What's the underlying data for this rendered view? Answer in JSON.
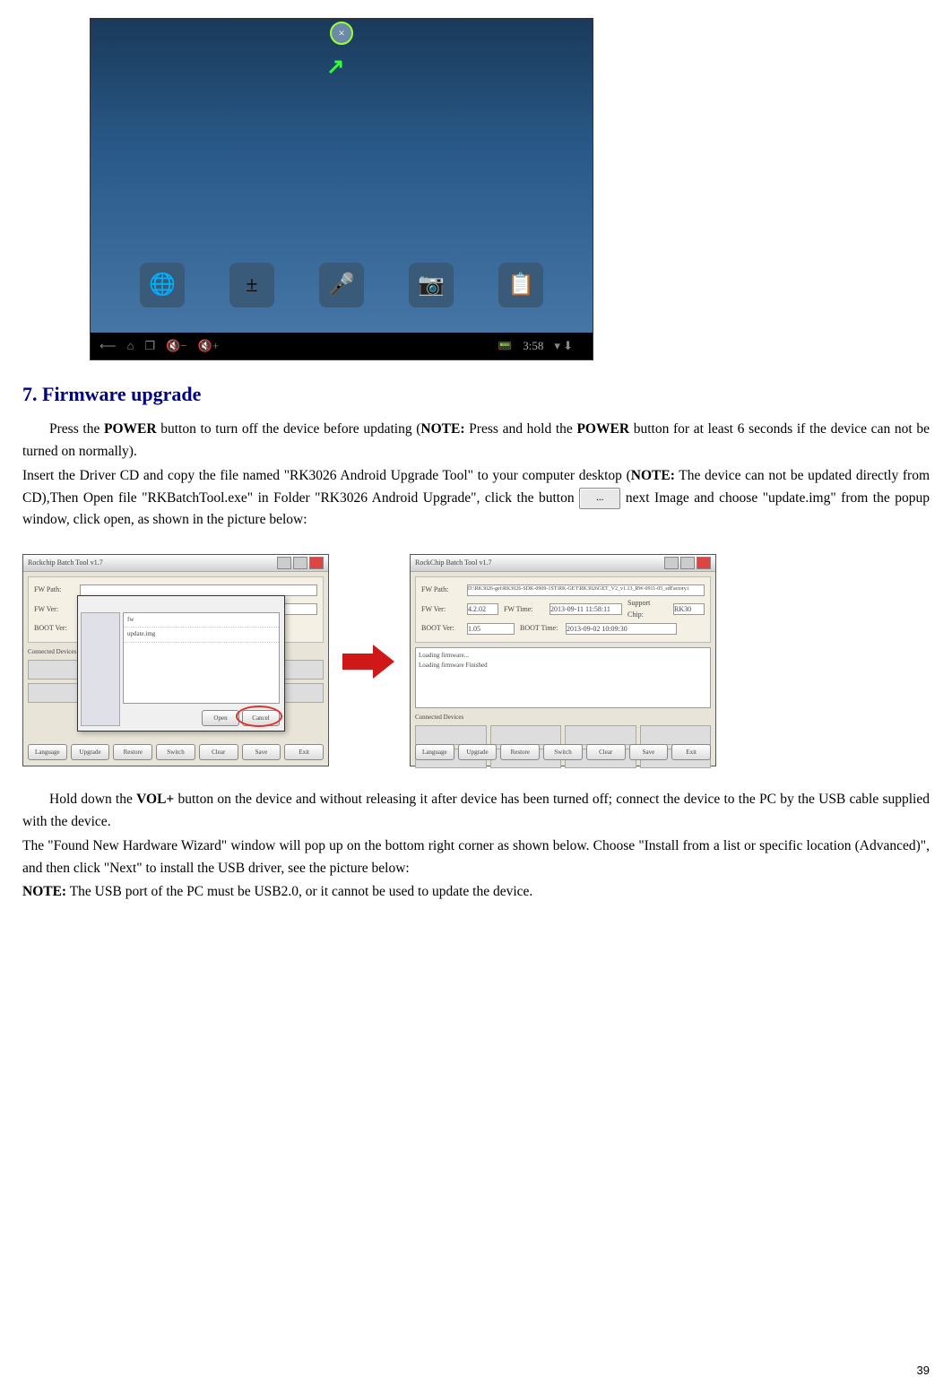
{
  "tablet": {
    "close_label": "×",
    "icons": [
      "🌐",
      "±",
      "🎤",
      "📷",
      "📋"
    ],
    "nav": [
      "⟵",
      "⌂",
      "❐",
      "🔇−",
      "🔇+"
    ],
    "time": "3:58",
    "status_icons": "▾ ⬇"
  },
  "heading": "7. Firmware upgrade",
  "para1_pre": "Press the ",
  "para1_power": "POWER",
  "para1_mid": " button to turn off the device before updating (",
  "para1_note1": "NOTE:",
  "para1_mid2": " Press and hold the ",
  "para1_power2": "POWER",
  "para1_post": " button for at least 6 seconds if the device can not be turned on normally).",
  "para2_pre": "Insert the Driver CD and copy the file named \"RK3026 Android Upgrade Tool\" to your computer desktop (",
  "para2_note": "NOTE:",
  "para2_mid": " The device can not be updated directly from CD),Then Open file \"RKBatchTool.exe\" in Folder \"RK3026 Android Upgrade\", click the button ",
  "browse_label": "...",
  "para2_post": " next Image and choose \"update.img\" from the popup window, click open, as shown in the picture below:",
  "tool": {
    "title_left": "Rockchip Batch Tool v1.7",
    "title_right": "RockChip Batch Tool v1.7",
    "labels": {
      "fw_path": "FW Path:",
      "fw_ver": "FW Ver:",
      "boot_ver": "BOOT Ver:",
      "fw_time": "FW Time:",
      "boot_time": "BOOT Time:",
      "support_chip": "Support Chip:"
    },
    "right_vals": {
      "fw_path": "D:\\RK3026-get\\RK3026-SDK-0909-1ST\\RK-GET\\RK3026GET_V2_v1.13_RW-0911-05_sdFactory.i",
      "fw_ver": "4.2.02",
      "fw_time": "2013-09-11 11:58:11",
      "boot_ver": "1.05",
      "boot_time": "2013-09-02 10:09:30",
      "support_chip": "RK30"
    },
    "log_lines": [
      "Loading firmware...",
      "Loading firmware Finished"
    ],
    "connected": "Connected Devices",
    "buttons": [
      "Language",
      "Upgrade",
      "Restore",
      "Switch",
      "Clear",
      "Save",
      "Exit"
    ],
    "dialog_items": [
      "fw",
      "update.img"
    ],
    "dialog_buttons": [
      "Open",
      "Cancel"
    ]
  },
  "para3_pre": "Hold down the ",
  "para3_vol": "VOL+",
  "para3_post": " button on the device and without releasing it after device has been turned off; connect the device to the PC by the USB cable supplied with the device.",
  "para4": "The \"Found New Hardware Wizard\" window will pop up on the bottom right corner as shown below. Choose \"Install from a list or specific location (Advanced)\", and then click \"Next\" to install the USB driver, see the picture below:",
  "para5_note": "NOTE:",
  "para5_post": " The USB port of the PC must be USB2.0, or it cannot be used to update the device.",
  "page_number": "39"
}
